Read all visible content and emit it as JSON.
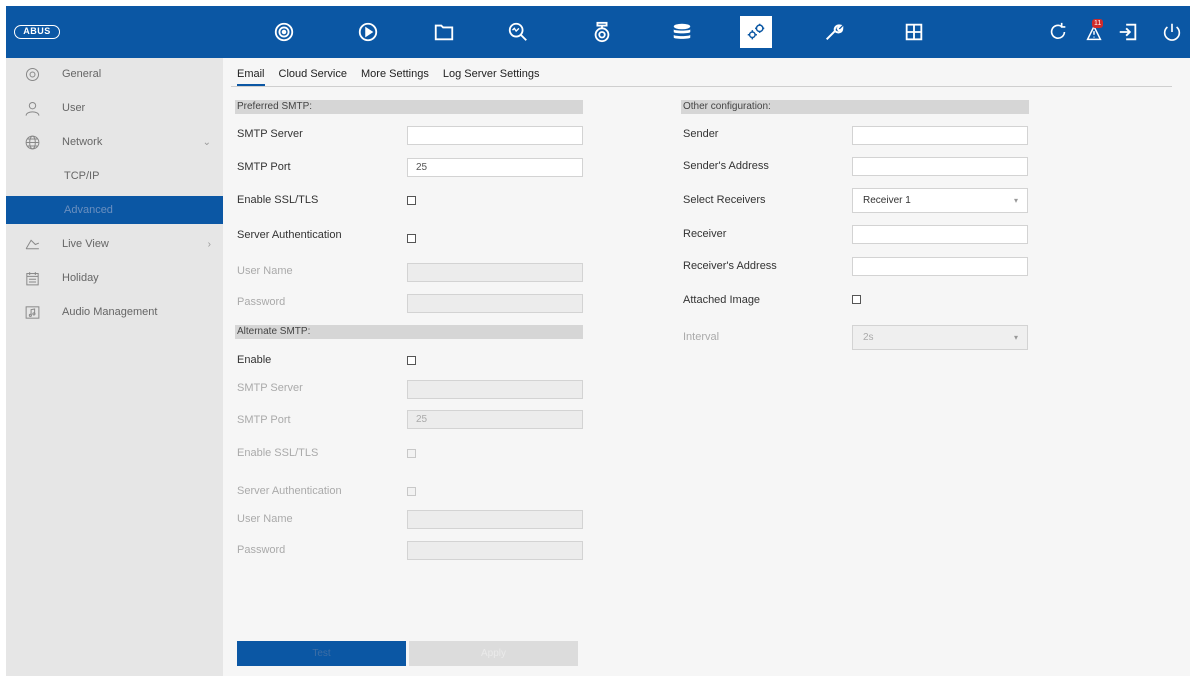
{
  "topbar": {
    "logo": "ABUS",
    "nav_icons": [
      "camera-ring-icon",
      "playback-icon",
      "folder-icon",
      "search-icon",
      "camera-icon",
      "storage-icon",
      "config-gears-icon",
      "maintenance-wrench-icon",
      "grid-view-icon"
    ],
    "active_icon": "config-gears-icon",
    "right_icons": [
      "refresh-icon",
      "alarm-icon",
      "logout-icon",
      "power-icon"
    ],
    "alarm_badge": "11",
    "brand_color": "#0b57a4"
  },
  "sidebar": {
    "items": [
      {
        "label": "General",
        "icon": "gear-icon"
      },
      {
        "label": "User",
        "icon": "user-icon"
      },
      {
        "label": "Network",
        "icon": "globe-icon",
        "chevron": "⌄"
      },
      {
        "label": "TCP/IP"
      },
      {
        "label": "Advanced"
      },
      {
        "label": "Live View",
        "icon": "live-view-icon",
        "chevron": "›"
      },
      {
        "label": "Holiday",
        "icon": "calendar-icon"
      },
      {
        "label": "Audio Management",
        "icon": "audio-icon"
      }
    ]
  },
  "tabs": [
    "Email",
    "Cloud Service",
    "More Settings",
    "Log Server Settings"
  ],
  "preferred": {
    "header": "Preferred SMTP:",
    "smtp_server_label": "SMTP Server",
    "smtp_server_value": "",
    "smtp_port_label": "SMTP Port",
    "smtp_port_value": "25",
    "ssl_label": "Enable SSL/TLS",
    "auth_label": "Server Authentication",
    "username_label": "User Name",
    "password_label": "Password"
  },
  "alternate": {
    "header": "Alternate SMTP:",
    "enable_label": "Enable",
    "smtp_server_label": "SMTP Server",
    "smtp_port_label": "SMTP Port",
    "smtp_port_value": "25",
    "ssl_label": "Enable SSL/TLS",
    "auth_label": "Server Authentication",
    "username_label": "User Name",
    "password_label": "Password"
  },
  "other": {
    "header": "Other configuration:",
    "sender_label": "Sender",
    "sender_address_label": "Sender's Address",
    "select_receivers_label": "Select Receivers",
    "select_receivers_value": "Receiver 1",
    "receiver_label": "Receiver",
    "receiver_address_label": "Receiver's Address",
    "attached_image_label": "Attached Image",
    "interval_label": "Interval",
    "interval_value": "2s"
  },
  "buttons": {
    "test": "Test",
    "apply": "Apply"
  }
}
